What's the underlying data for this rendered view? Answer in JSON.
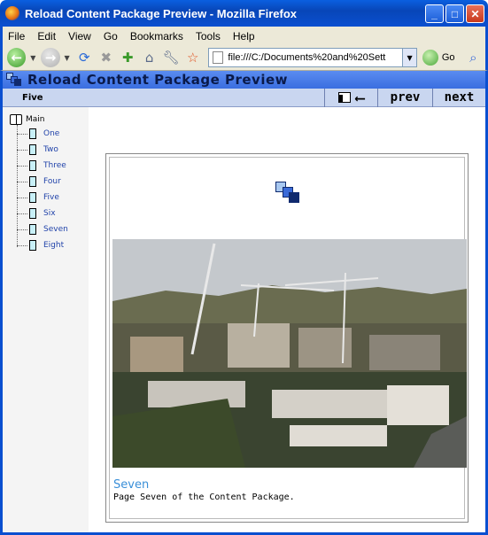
{
  "window": {
    "title": "Reload Content Package Preview - Mozilla Firefox",
    "buttons": {
      "minimize": "_",
      "maximize": "□",
      "close": "✕"
    }
  },
  "menu": [
    "File",
    "Edit",
    "View",
    "Go",
    "Bookmarks",
    "Tools",
    "Help"
  ],
  "navbar": {
    "url": "file:///C:/Documents%20and%20Sett",
    "go_label": "Go"
  },
  "header": {
    "title": "Reload Content Package Preview"
  },
  "nav": {
    "current": "Five",
    "prev_label": "prev",
    "next_label": "next"
  },
  "tree": {
    "root": "Main",
    "items": [
      "One",
      "Two",
      "Three",
      "Four",
      "Five",
      "Six",
      "Seven",
      "Eight"
    ]
  },
  "content": {
    "page_title": "Seven",
    "page_desc": "Page Seven of the Content Package."
  },
  "colors": {
    "accent": "#5a8cf0",
    "nav_bg": "#c9d6f0",
    "link": "#2244aa",
    "heading": "#3a8fd8"
  }
}
